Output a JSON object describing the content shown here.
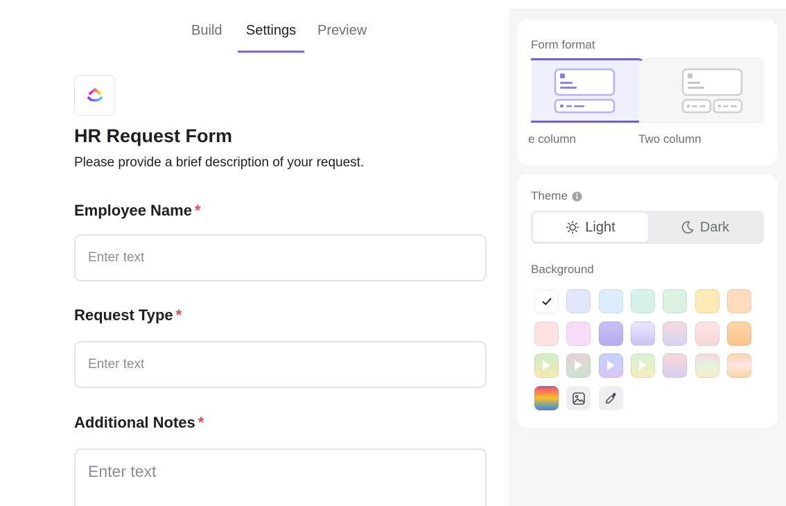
{
  "tabs": [
    {
      "label": "Build"
    },
    {
      "label": "Settings",
      "active": true
    },
    {
      "label": "Preview"
    }
  ],
  "form": {
    "title": "HR Request Form",
    "description": "Please provide a brief description of your request.",
    "fields": [
      {
        "label": "Employee Name",
        "required_mark": "*",
        "placeholder": "Enter text"
      },
      {
        "label": "Request Type",
        "required_mark": "*",
        "placeholder": "Enter text"
      },
      {
        "label": "Additional Notes",
        "required_mark": "*",
        "placeholder": "Enter text"
      }
    ]
  },
  "panel": {
    "form_format": {
      "label": "Form format",
      "options": [
        {
          "label": "e column",
          "selected": true
        },
        {
          "label": "Two column",
          "selected": false
        }
      ]
    },
    "theme": {
      "label": "Theme",
      "light_label": "Light",
      "dark_label": "Dark",
      "selected": "Light"
    },
    "background": {
      "label": "Background",
      "selected_index": 0,
      "swatches": [
        {
          "kind": "color",
          "color": "#ffffff",
          "icon": "checkmark-icon"
        },
        {
          "kind": "color",
          "color": "#e3e7fb"
        },
        {
          "kind": "color",
          "color": "#dcedfc"
        },
        {
          "kind": "color",
          "color": "#d6f1ec"
        },
        {
          "kind": "color",
          "color": "#dbf1e1"
        },
        {
          "kind": "color",
          "color": "#fdeab4"
        },
        {
          "kind": "color",
          "color": "#fddcbe"
        },
        {
          "kind": "color",
          "color": "#fde1e3"
        },
        {
          "kind": "color",
          "color": "#f6dcf6"
        },
        {
          "kind": "gradient",
          "colors": [
            "#cbbcf7",
            "#b9a9f0"
          ]
        },
        {
          "kind": "gradient",
          "colors": [
            "#eee7ff",
            "#c7c3f5"
          ]
        },
        {
          "kind": "gradient",
          "colors": [
            "#f7dbe0",
            "#d6d3f2"
          ]
        },
        {
          "kind": "gradient",
          "colors": [
            "#fde4e4",
            "#f6d8da"
          ]
        },
        {
          "kind": "gradient",
          "colors": [
            "#fdd6a8",
            "#fbc38b"
          ]
        },
        {
          "kind": "video",
          "colors": [
            "#cdeecb",
            "#f8e8b0"
          ]
        },
        {
          "kind": "video",
          "colors": [
            "#e6d3d6",
            "#cfe2d3"
          ]
        },
        {
          "kind": "video",
          "colors": [
            "#c3d3fa",
            "#d8c6f6"
          ]
        },
        {
          "kind": "video",
          "colors": [
            "#d3f3d8",
            "#f6eebb"
          ]
        },
        {
          "kind": "gradient",
          "colors": [
            "#fbd7d7",
            "#d6d0f4"
          ]
        },
        {
          "kind": "gradient",
          "colors": [
            "#f8d7e2",
            "#e3f3dd",
            "#f9ecc7"
          ]
        },
        {
          "kind": "gradient",
          "colors": [
            "#fdd1b2",
            "#fde7e0",
            "#fbd4a6"
          ]
        },
        {
          "kind": "gradient",
          "colors": [
            "#f44b73",
            "#f9c22e",
            "#2f8fe0"
          ]
        },
        {
          "kind": "tool",
          "icon": "image-upload-icon"
        },
        {
          "kind": "tool",
          "icon": "eyedropper-icon"
        }
      ]
    }
  },
  "colors": {
    "accent": "#7b68ee",
    "required": "#e5484d",
    "panel_bg": "#f5f5f6"
  }
}
